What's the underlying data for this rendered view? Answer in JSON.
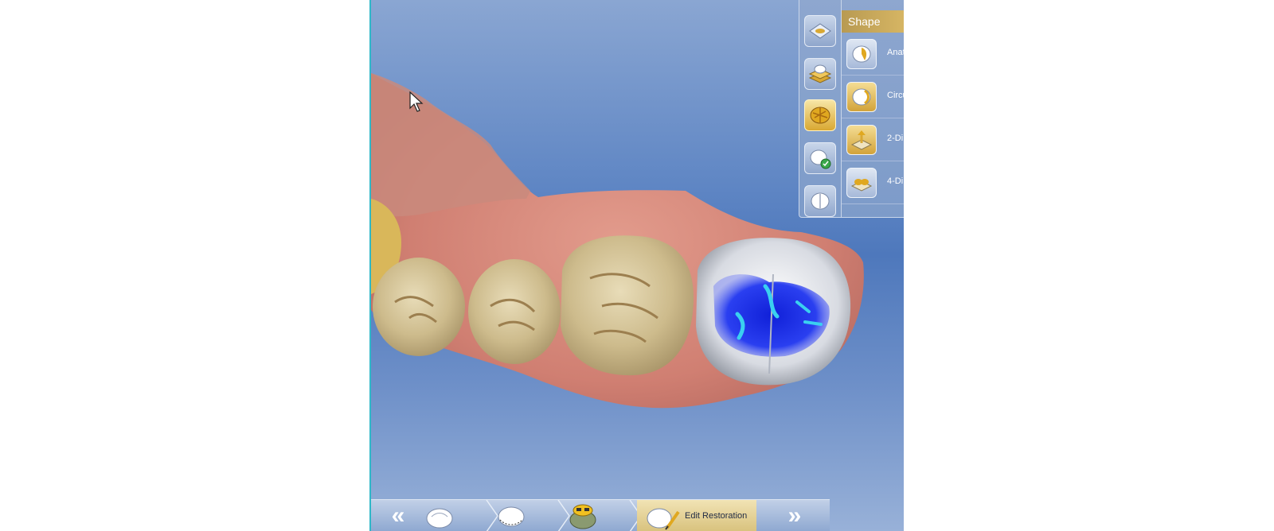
{
  "tool_panel": {
    "section_title": "Shape",
    "rail_tools": [
      {
        "icon": "preparation-margin-icon"
      },
      {
        "icon": "layers-icon"
      },
      {
        "icon": "shape-tool-icon",
        "active": true
      },
      {
        "icon": "tooth-check-icon"
      },
      {
        "icon": "tooth-split-icon"
      }
    ],
    "shape_tools": [
      {
        "label": "Anat",
        "icon": "anatomic-shape-icon",
        "active": false
      },
      {
        "label": "Circu",
        "icon": "circular-shape-icon",
        "active": true
      },
      {
        "label": "2-Di",
        "icon": "two-dimensional-shape-icon",
        "active": false
      },
      {
        "label": "4-Di",
        "icon": "four-dimensional-shape-icon",
        "active": false
      }
    ]
  },
  "step_bar": {
    "prev_label": "«",
    "next_label": "»",
    "steps": [
      {
        "icon": "prepare-model-icon",
        "label": ""
      },
      {
        "icon": "margin-icon",
        "label": ""
      },
      {
        "icon": "propose-icon",
        "label": ""
      },
      {
        "icon": "edit-restoration-icon",
        "label": "Edit Restoration",
        "active": true
      }
    ]
  },
  "colors": {
    "viewport_top": "#8aa6d2",
    "viewport_mid": "#4e78bc",
    "panel_accent": "#d9b865",
    "active_step": "#d8c27d",
    "crown_contact_blue": "#1a2fe0",
    "gingiva": "#d98a7c",
    "tooth_enamel": "#d8c8a0"
  }
}
